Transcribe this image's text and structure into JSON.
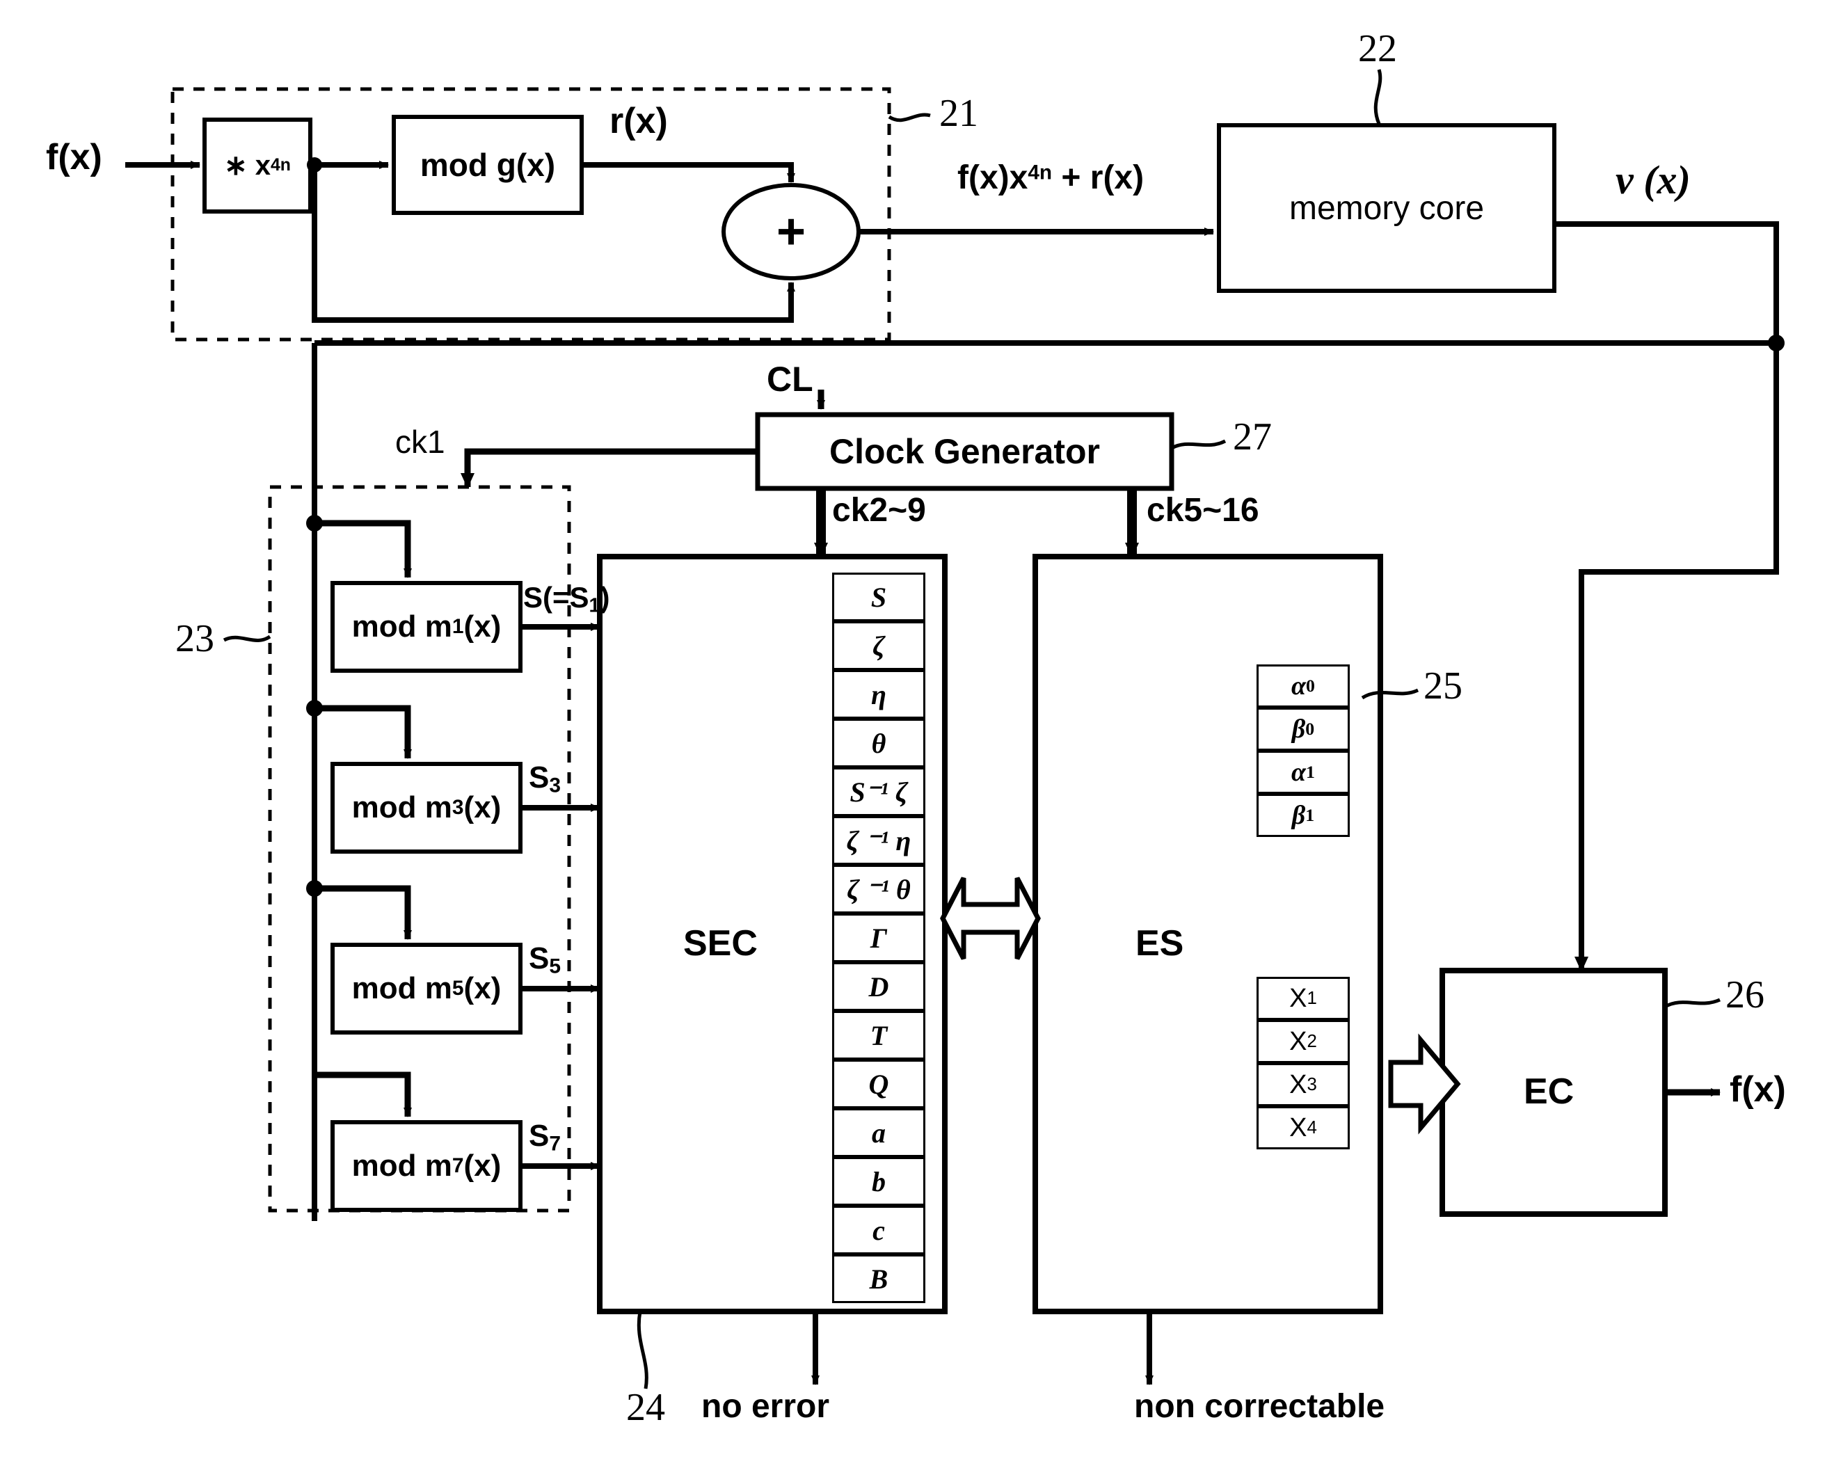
{
  "diagram": {
    "title": "ECC memory block diagram",
    "stroke_color": "#000000",
    "background": "#ffffff"
  },
  "signals": {
    "input_fx": "f(x)",
    "rx": "r(x)",
    "encoded": "f(x)x",
    "encoded_sup": "4n",
    "encoded_tail": " + r(x)",
    "vx": "ν (x)",
    "clock_in": "CL",
    "ck1": "ck1",
    "ck2_9": "ck2~9",
    "ck5_16": "ck5~16",
    "s_main": "S(=S",
    "s_main_sub": "1",
    "s_main_tail": ")",
    "s3": "S",
    "s3_sub": "3",
    "s5": "S",
    "s5_sub": "5",
    "s7": "S",
    "s7_sub": "7",
    "output_fx": "f(x)",
    "no_error": "no error",
    "non_correctable": "non correctable"
  },
  "blocks": {
    "multiplier": {
      "label": "∗ x",
      "sup": "4n"
    },
    "mod_g": {
      "label": "mod g(x)"
    },
    "adder": {
      "label": "+"
    },
    "memory_core": {
      "label": "memory core"
    },
    "clock_generator": {
      "label": "Clock Generator"
    },
    "sec": {
      "label": "SEC"
    },
    "es": {
      "label": "ES"
    },
    "ec": {
      "label": "EC"
    },
    "mod_m": [
      {
        "label": "mod m",
        "sub": "1",
        "tail": "(x)"
      },
      {
        "label": "mod m",
        "sub": "3",
        "tail": "(x)"
      },
      {
        "label": "mod m",
        "sub": "5",
        "tail": "(x)"
      },
      {
        "label": "mod m",
        "sub": "7",
        "tail": "(x)"
      }
    ]
  },
  "reference_numerals": {
    "encoder": "21",
    "memory": "22",
    "syndrome_generator": "23",
    "sec_unit": "24",
    "es_registers": "25",
    "ec_unit": "26",
    "clock_unit": "27"
  },
  "sec_registers": [
    "S",
    "ζ",
    "η",
    "θ",
    "S⁻¹ ζ",
    "ζ ⁻¹ η",
    "ζ ⁻¹ θ",
    "Γ",
    "D",
    "T",
    "Q",
    "a",
    "b",
    "c",
    "B"
  ],
  "es_registers_upper": [
    "α 0",
    "β 0",
    "α 1",
    "β 1"
  ],
  "es_registers_lower": [
    "X 1",
    "X 2",
    "X 3",
    "X 4"
  ]
}
